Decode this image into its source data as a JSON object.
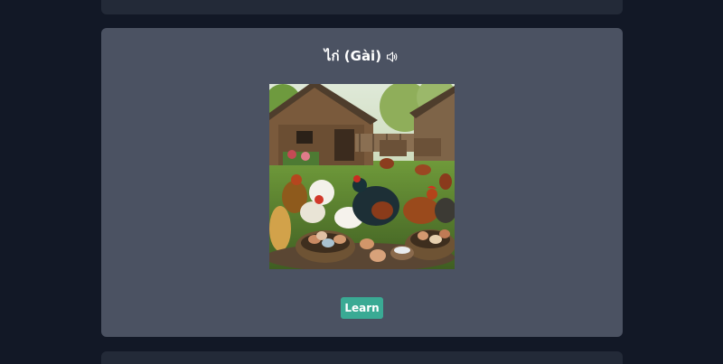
{
  "lesson": {
    "word": "ไก่ (Gài)",
    "audio_icon": "speaker-icon",
    "image_icon": "chicken-farm-illustration",
    "learn_label": "Learn"
  },
  "colors": {
    "background": "#121826",
    "card": "#4b5262",
    "adjacent_card": "#232a38",
    "accent": "#3aaa94"
  }
}
